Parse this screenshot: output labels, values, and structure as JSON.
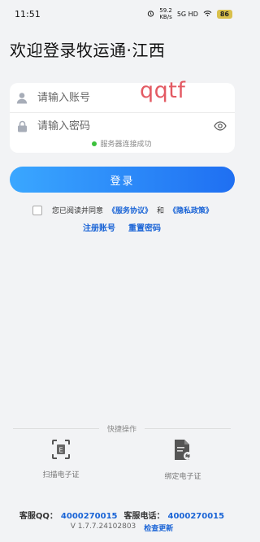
{
  "status_bar": {
    "time": "11:51",
    "net_speed_value": "59.2",
    "net_speed_unit": "KB/s",
    "network": "5G HD",
    "battery": "86"
  },
  "page_title": "欢迎登录牧运通·江西",
  "watermark": "qqtf",
  "account_field": {
    "placeholder": "请输入账号",
    "value": ""
  },
  "password_field": {
    "placeholder": "请输入密码",
    "value": ""
  },
  "server_status": "服务器连接成功",
  "login_button": "登录",
  "agreement": {
    "prefix": "您已阅读并同意",
    "service_link": "《服务协议》",
    "conjunction": "和",
    "privacy_link": "《隐私政策》"
  },
  "links": {
    "register": "注册账号",
    "reset_password": "重置密码"
  },
  "quick_actions": {
    "title": "快捷操作",
    "scan": "扫描电子证",
    "bind": "绑定电子证"
  },
  "footer": {
    "qq_label": "客服QQ：",
    "qq_value": "4000270015",
    "phone_label": "客服电话：",
    "phone_value": "4000270015",
    "version": "V 1.7.7.24102803",
    "check_update": "检查更新"
  },
  "colors": {
    "accent": "#1a64d6",
    "button_start": "#3aa7ff",
    "button_end": "#1f6ff2",
    "online": "#3cc13c"
  }
}
